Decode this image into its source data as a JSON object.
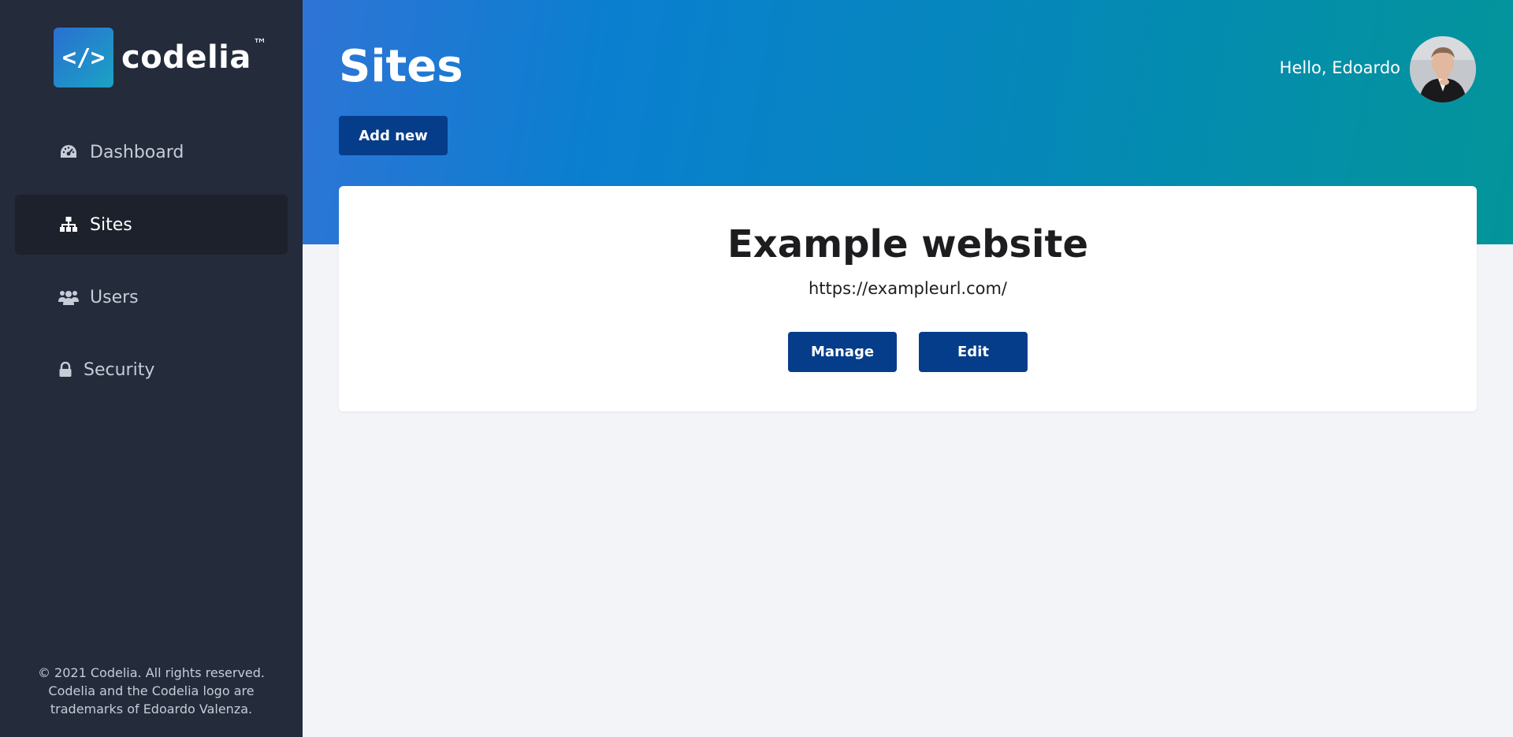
{
  "brand": {
    "logo_symbol": "</>",
    "name": "codelia",
    "tm": "™"
  },
  "sidebar": {
    "items": [
      {
        "label": "Dashboard",
        "icon": "dashboard-gauge-icon",
        "active": false
      },
      {
        "label": "Sites",
        "icon": "sitemap-icon",
        "active": true
      },
      {
        "label": "Users",
        "icon": "users-icon",
        "active": false
      },
      {
        "label": "Security",
        "icon": "lock-icon",
        "active": false
      }
    ],
    "footer": {
      "line1": "© 2021 Codelia. All rights reserved.",
      "line2": "Codelia and the Codelia logo are",
      "line3": "trademarks of Edoardo Valenza."
    }
  },
  "header": {
    "title": "Sites",
    "add_label": "Add new",
    "greeting": "Hello, Edoardo"
  },
  "site_card": {
    "title": "Example website",
    "url": "https://exampleurl.com/",
    "manage_label": "Manage",
    "edit_label": "Edit"
  },
  "colors": {
    "sidebar_bg": "#242b3b",
    "active_item_bg": "#1c212c",
    "button_bg": "#063d8a",
    "header_gradient_start": "#2f74d6",
    "header_gradient_end": "#03959a",
    "page_bg": "#f3f4f8"
  }
}
